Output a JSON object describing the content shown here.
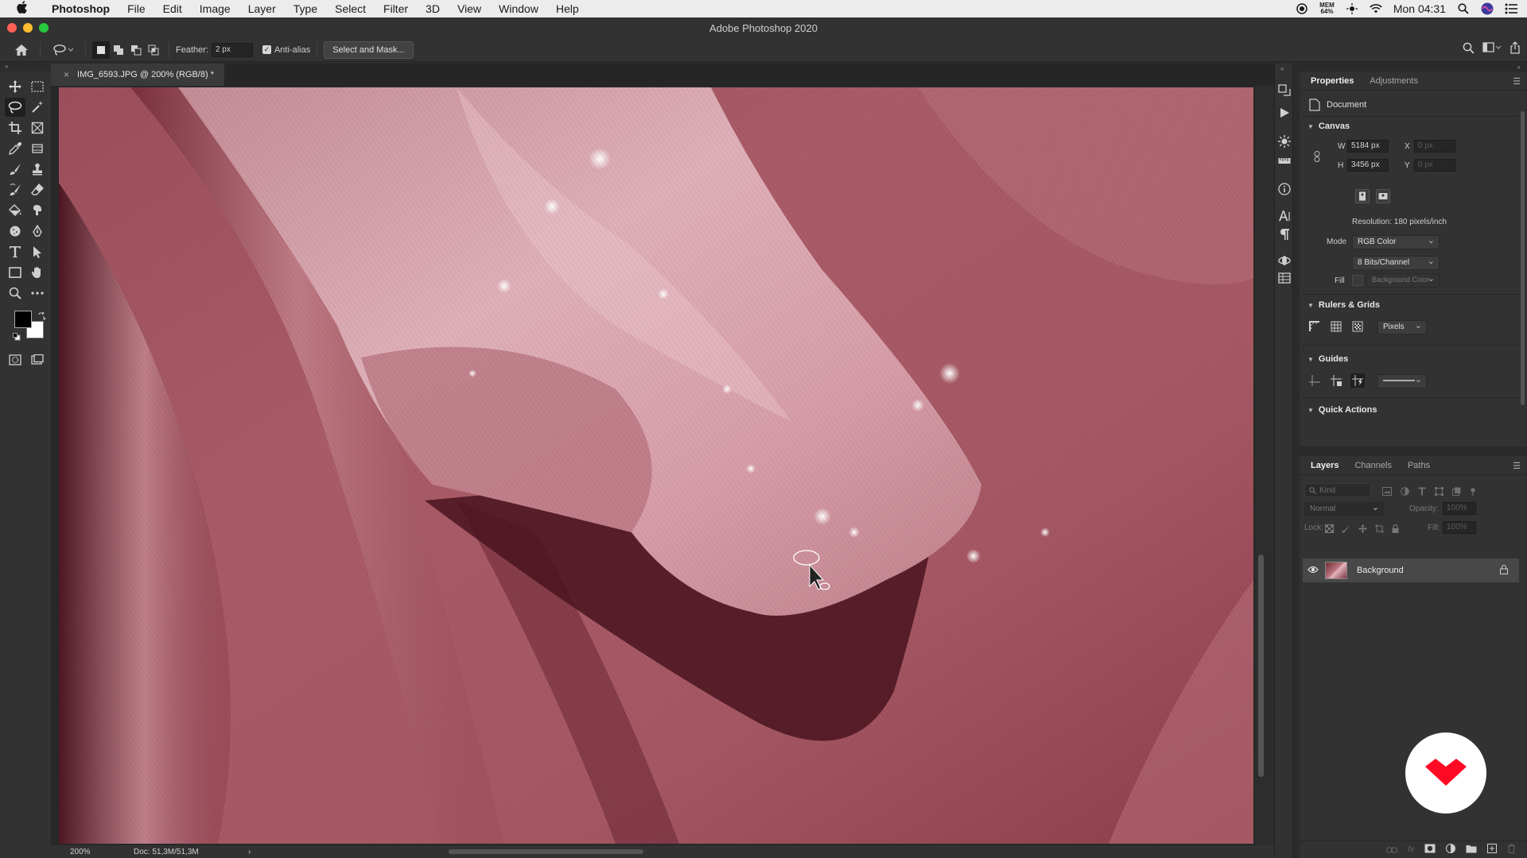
{
  "menubar": {
    "app_name": "Photoshop",
    "items": [
      "File",
      "Edit",
      "Image",
      "Layer",
      "Type",
      "Select",
      "Filter",
      "3D",
      "View",
      "Window",
      "Help"
    ],
    "mem_label": "MEM",
    "mem_value": "64%",
    "clock": "Mon 04:31"
  },
  "window": {
    "title": "Adobe Photoshop 2020"
  },
  "options": {
    "feather_label": "Feather:",
    "feather_value": "2 px",
    "antialias_label": "Anti-alias",
    "antialias_checked": true,
    "select_mask_label": "Select and Mask..."
  },
  "document": {
    "tab_title": "IMG_6593.JPG @ 200% (RGB/8) *",
    "close_glyph": "×"
  },
  "status": {
    "zoom": "200%",
    "doc_info": "Doc: 51,3M/51,3M",
    "arrow": "›"
  },
  "properties": {
    "tabs": [
      "Properties",
      "Adjustments"
    ],
    "doc_label": "Document",
    "canvas": {
      "header": "Canvas",
      "w_label": "W",
      "w_value": "5184 px",
      "h_label": "H",
      "h_value": "3456 px",
      "x_label": "X",
      "x_value": "0 px",
      "y_label": "Y",
      "y_value": "0 px",
      "resolution": "Resolution: 180 pixels/inch",
      "mode_label": "Mode",
      "mode_value": "RGB Color",
      "depth_value": "8 Bits/Channel",
      "fill_label": "Fill",
      "fill_value": "Background Color"
    },
    "rulers": {
      "header": "Rulers & Grids",
      "units": "Pixels"
    },
    "guides": {
      "header": "Guides"
    },
    "quick_actions": {
      "header": "Quick Actions"
    }
  },
  "layers": {
    "tabs": [
      "Layers",
      "Channels",
      "Paths"
    ],
    "kind_placeholder": "Kind",
    "blend_mode": "Normal",
    "opacity_label": "Opacity:",
    "opacity_value": "100%",
    "lock_label": "Lock:",
    "fill_label": "Fill:",
    "fill_value": "100%",
    "rows": [
      {
        "name": "Background",
        "visible": true,
        "locked": true
      }
    ]
  },
  "colors": {
    "accent_logo": "#ff0a25",
    "foreground": "#000000",
    "background": "#ffffff"
  }
}
